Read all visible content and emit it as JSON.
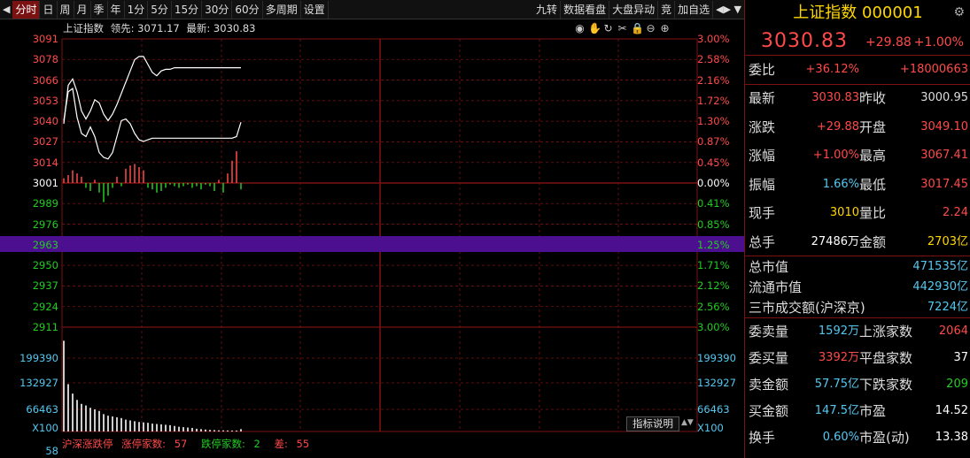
{
  "toolbar": {
    "left_arrow": "◀",
    "tabs": [
      "分时",
      "日",
      "周",
      "月",
      "季",
      "年",
      "1分",
      "5分",
      "15分",
      "30分",
      "60分",
      "多周期",
      "设置"
    ],
    "right_tabs": [
      "九转",
      "数据看盘",
      "大盘异动",
      "竞",
      "加自选"
    ],
    "right_arrows": "◀▶ ▼"
  },
  "chart_info": {
    "name": "上证指数",
    "lead": "领先: 3071.17",
    "latest": "最新: 3030.83"
  },
  "chart_icons": [
    "eye-icon",
    "hand-icon",
    "refresh-icon",
    "scissors-icon",
    "lock-icon",
    "zoom-out-icon",
    "zoom-in-icon"
  ],
  "price_axis": {
    "left": [
      {
        "v": "3091",
        "c": "red"
      },
      {
        "v": "3078",
        "c": "red"
      },
      {
        "v": "3066",
        "c": "red"
      },
      {
        "v": "3053",
        "c": "red"
      },
      {
        "v": "3040",
        "c": "red"
      },
      {
        "v": "3027",
        "c": "red"
      },
      {
        "v": "3014",
        "c": "red"
      },
      {
        "v": "3001",
        "c": "white"
      },
      {
        "v": "2989",
        "c": "green"
      },
      {
        "v": "2976",
        "c": "green"
      },
      {
        "v": "2963",
        "c": "green"
      },
      {
        "v": "2950",
        "c": "green"
      },
      {
        "v": "2937",
        "c": "green"
      },
      {
        "v": "2924",
        "c": "green"
      },
      {
        "v": "2911",
        "c": "green"
      }
    ],
    "right": [
      {
        "v": "3.00%",
        "c": "red"
      },
      {
        "v": "2.58%",
        "c": "red"
      },
      {
        "v": "2.16%",
        "c": "red"
      },
      {
        "v": "1.72%",
        "c": "red"
      },
      {
        "v": "1.30%",
        "c": "red"
      },
      {
        "v": "0.87%",
        "c": "red"
      },
      {
        "v": "0.45%",
        "c": "red"
      },
      {
        "v": "0.00%",
        "c": "white"
      },
      {
        "v": "0.41%",
        "c": "green"
      },
      {
        "v": "0.85%",
        "c": "green"
      },
      {
        "v": "1.25%",
        "c": "green"
      },
      {
        "v": "1.71%",
        "c": "green"
      },
      {
        "v": "2.12%",
        "c": "green"
      },
      {
        "v": "2.56%",
        "c": "green"
      },
      {
        "v": "3.00%",
        "c": "green"
      }
    ]
  },
  "volume_axis": {
    "left": [
      "199390",
      "132927",
      "66463",
      "X100"
    ],
    "right": [
      "199390",
      "132927",
      "66463",
      "X100"
    ],
    "bottom_left": "58"
  },
  "chart_data": {
    "type": "line",
    "base": 3001,
    "price_range": [
      2911,
      3091
    ],
    "index_line": [
      3038,
      3062,
      3066,
      3058,
      3046,
      3041,
      3046,
      3053,
      3051,
      3044,
      3040,
      3044,
      3050,
      3057,
      3064,
      3071,
      3078,
      3080,
      3080,
      3075,
      3070,
      3068,
      3071,
      3072,
      3072,
      3073,
      3073,
      3073,
      3073,
      3073,
      3073,
      3073,
      3073,
      3073,
      3073,
      3073,
      3073,
      3073,
      3073,
      3073,
      3073
    ],
    "lead_line": [
      3040,
      3058,
      3060,
      3042,
      3032,
      3030,
      3036,
      3030,
      3020,
      3017,
      3016,
      3020,
      3030,
      3040,
      3041,
      3038,
      3032,
      3028,
      3027,
      3028,
      3029,
      3029,
      3029,
      3029,
      3029,
      3029,
      3029,
      3029,
      3029,
      3029,
      3029,
      3029,
      3029,
      3029,
      3029,
      3029,
      3029,
      3029,
      3029,
      3030,
      3039
    ],
    "red_green_bars": [
      3,
      5,
      8,
      6,
      4,
      -3,
      -5,
      2,
      -6,
      -12,
      -8,
      -3,
      4,
      -2,
      9,
      11,
      12,
      10,
      8,
      -3,
      -4,
      -6,
      -5,
      -3,
      -1,
      -2,
      -3,
      -2,
      -1,
      -3,
      -2,
      -4,
      -1,
      -2,
      -5,
      2,
      -6,
      6,
      14,
      20,
      -4
    ],
    "volume": [
      1150,
      600,
      480,
      400,
      350,
      330,
      300,
      280,
      260,
      220,
      200,
      190,
      180,
      170,
      150,
      140,
      130,
      120,
      115,
      110,
      100,
      95,
      90,
      85,
      80,
      70,
      60,
      55,
      50,
      45,
      35,
      30,
      25,
      20,
      18,
      15,
      14,
      13,
      12,
      12,
      30
    ],
    "volume_max": 1300
  },
  "bottom_bar": {
    "title": "沪深涨跌停",
    "up_label": "涨停家数:",
    "up": "57",
    "down_label": "跌停家数:",
    "down": "2",
    "diff_label": "差:",
    "diff": "55"
  },
  "indicator_button": "指标说明",
  "indicator_arrows": "▲▼",
  "panel": {
    "title": "上证指数 000001",
    "price": "3030.83",
    "change": "+29.88",
    "change_pct": "+1.00%",
    "rows": [
      {
        "l1": "委比",
        "v1": "+36.12%",
        "c1": "red",
        "l2": "",
        "v2": "+18000663",
        "c2": "red"
      },
      {
        "l1": "最新",
        "v1": "3030.83",
        "c1": "red",
        "l2": "昨收",
        "v2": "3000.95",
        "c2": "grayw"
      },
      {
        "l1": "涨跌",
        "v1": "+29.88",
        "c1": "red",
        "l2": "开盘",
        "v2": "3049.10",
        "c2": "red"
      },
      {
        "l1": "涨幅",
        "v1": "+1.00%",
        "c1": "red",
        "l2": "最高",
        "v2": "3067.41",
        "c2": "red"
      },
      {
        "l1": "振幅",
        "v1": "1.66%",
        "c1": "cyan",
        "l2": "最低",
        "v2": "3017.45",
        "c2": "red"
      },
      {
        "l1": "现手",
        "v1": "3010",
        "c1": "yellow",
        "l2": "量比",
        "v2": "2.24",
        "c2": "red"
      },
      {
        "l1": "总手",
        "v1": "27486万",
        "c1": "white",
        "l2": "金额",
        "v2": "2703亿",
        "c2": "yellow"
      }
    ],
    "srows": [
      {
        "l": "总市值",
        "v": "471535亿"
      },
      {
        "l": "流通市值",
        "v": "442930亿"
      },
      {
        "l": "三市成交额(沪深京)",
        "v": "7224亿"
      }
    ],
    "rows2": [
      {
        "l1": "委卖量",
        "v1": "1592万",
        "c1": "cyan",
        "l2": "上涨家数",
        "v2": "2064",
        "c2": "red"
      },
      {
        "l1": "委买量",
        "v1": "3392万",
        "c1": "red",
        "l2": "平盘家数",
        "v2": "37",
        "c2": "white"
      },
      {
        "l1": "卖金额",
        "v1": "57.75亿",
        "c1": "cyan",
        "l2": "下跌家数",
        "v2": "209",
        "c2": "green"
      },
      {
        "l1": "买金额",
        "v1": "147.5亿",
        "c1": "cyan",
        "l2": "市盈",
        "v2": "14.52",
        "c2": "white"
      },
      {
        "l1": "换手",
        "v1": "0.60%",
        "c1": "cyan",
        "l2": "市盈(动)",
        "v2": "13.38",
        "c2": "white"
      }
    ]
  },
  "colors": {
    "grid": "#7a1212",
    "up": "#ff4a4a",
    "down": "#22cc22",
    "highlight": "#4b0f8f",
    "line": "#ffffff"
  }
}
